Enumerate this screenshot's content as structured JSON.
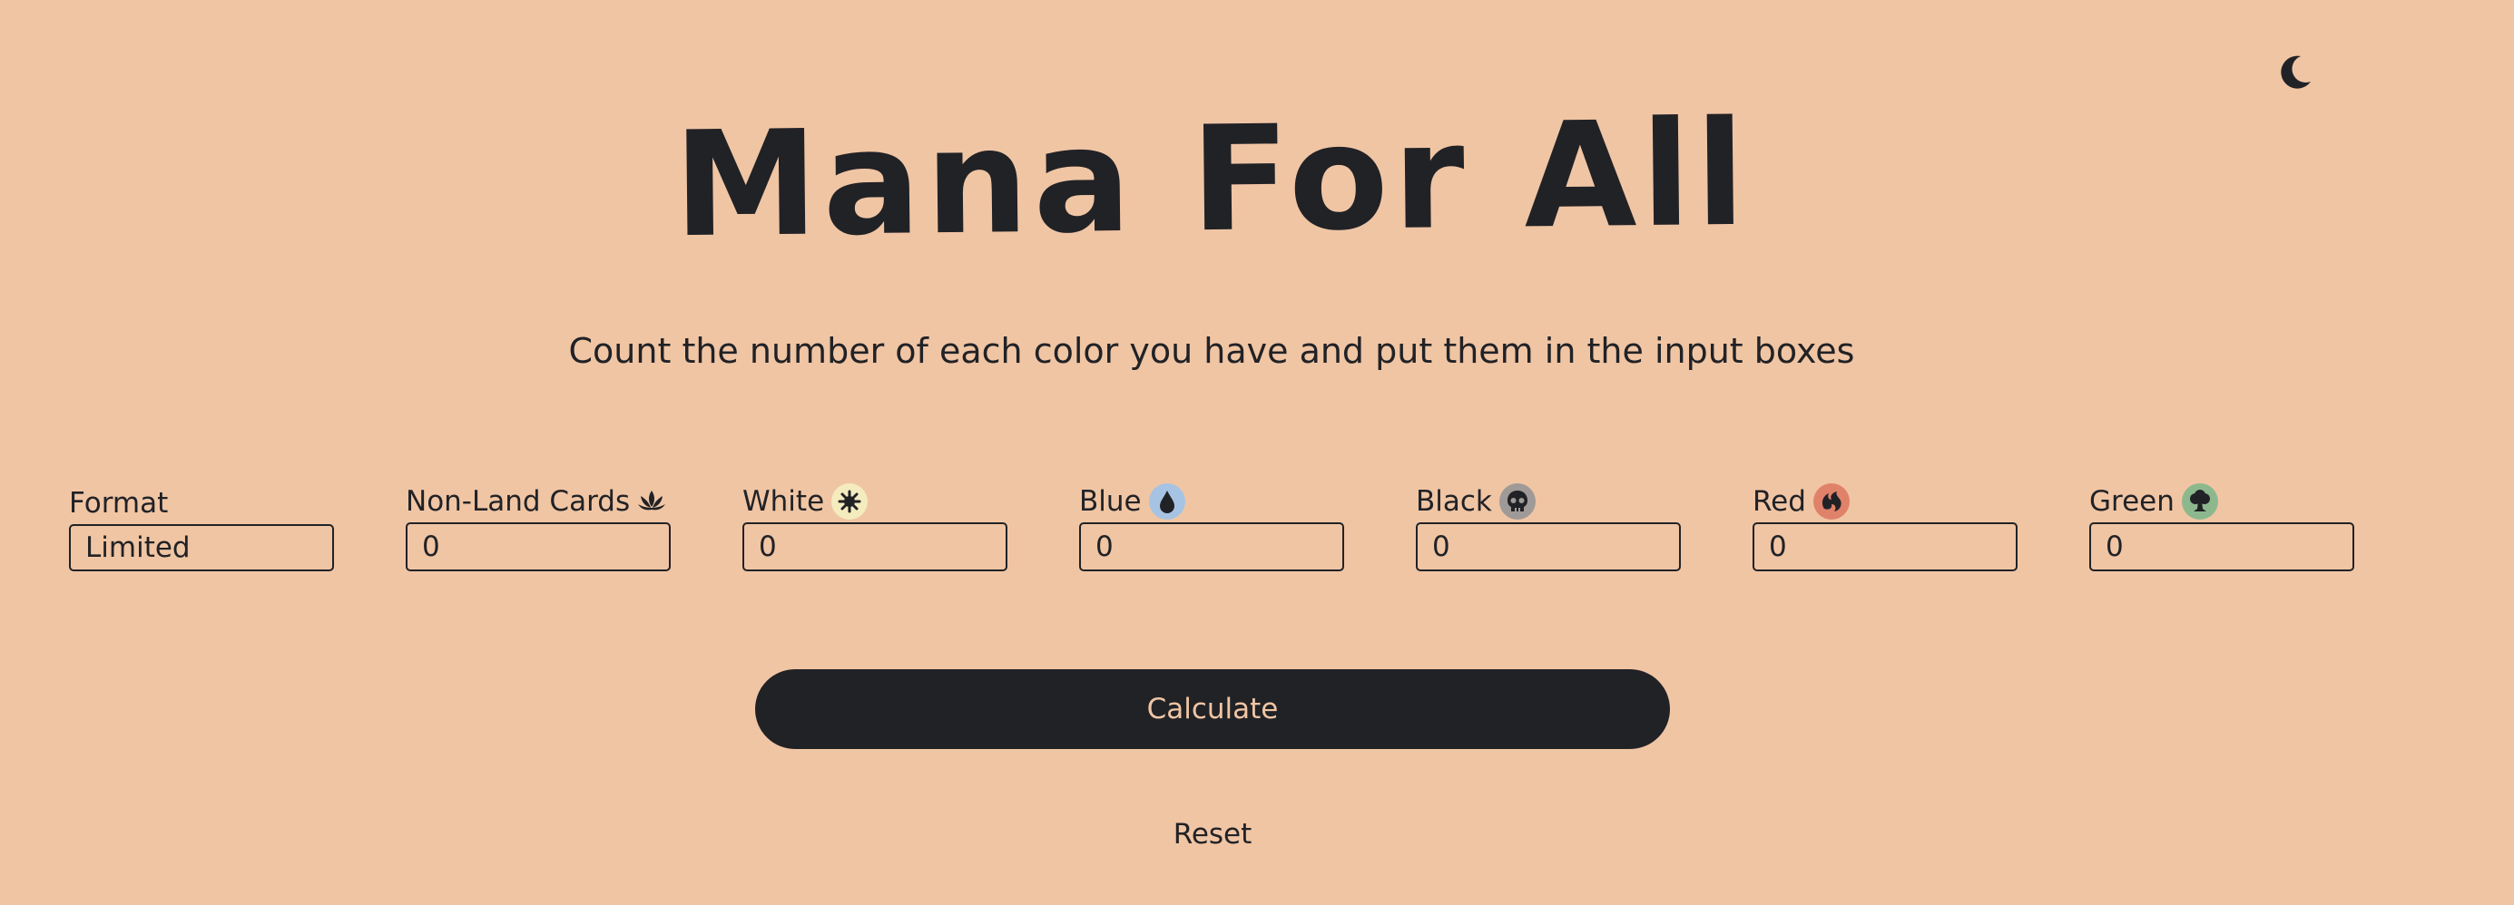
{
  "header": {
    "title": "Mana For All",
    "theme_toggle_icon": "moon-icon",
    "subtitle": "Count the number of each color you have and put them in the input boxes"
  },
  "fields": {
    "format": {
      "label": "Format",
      "value": "Limited"
    },
    "nonland": {
      "label": "Non-Land Cards",
      "value": "0",
      "icon": "lotus-icon"
    },
    "white": {
      "label": "White",
      "value": "0",
      "icon": "white-mana-icon",
      "badge_color": "#f4ecbf"
    },
    "blue": {
      "label": "Blue",
      "value": "0",
      "icon": "blue-mana-icon",
      "badge_color": "#a6c3e3"
    },
    "black": {
      "label": "Black",
      "value": "0",
      "icon": "black-mana-icon",
      "badge_color": "#9f9a97"
    },
    "red": {
      "label": "Red",
      "value": "0",
      "icon": "red-mana-icon",
      "badge_color": "#e0826a"
    },
    "green": {
      "label": "Green",
      "value": "0",
      "icon": "green-mana-icon",
      "badge_color": "#8db88e"
    }
  },
  "actions": {
    "calculate_label": "Calculate",
    "reset_label": "Reset"
  },
  "colors": {
    "background": "#f0c5a4",
    "foreground": "#212226"
  }
}
